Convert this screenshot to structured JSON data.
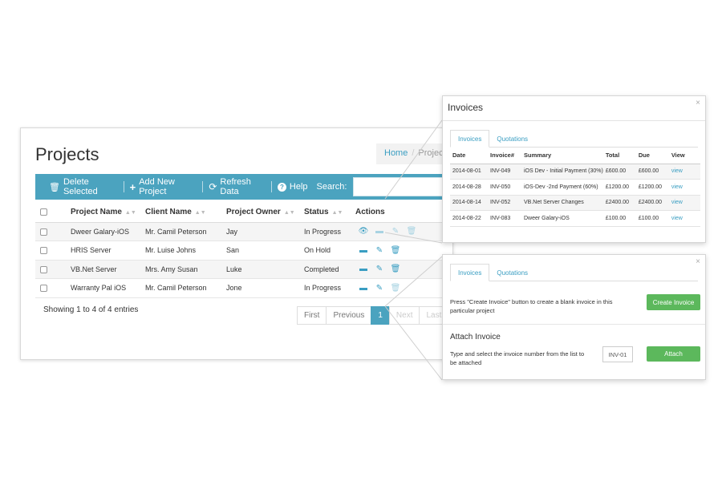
{
  "projects_panel": {
    "title": "Projects",
    "breadcrumb": {
      "home": "Home",
      "separator": "/",
      "current": "Project"
    },
    "toolbar": {
      "delete_selected": "Delete Selected",
      "add_new_project": "Add New Project",
      "refresh_data": "Refresh Data",
      "help": "Help",
      "search_label": "Search:",
      "search_value": ""
    },
    "table": {
      "headers": [
        "Project Name",
        "Client Name",
        "Project Owner",
        "Status",
        "Actions"
      ],
      "rows": [
        {
          "project_name": "Dweer Galary-iOS",
          "client_name": "Mr. Camil Peterson",
          "project_owner": "Jay",
          "status": "In Progress"
        },
        {
          "project_name": "HRIS Server",
          "client_name": "Mr. Luise Johns",
          "project_owner": "San",
          "status": "On Hold"
        },
        {
          "project_name": "VB.Net Server",
          "client_name": "Mrs. Amy Susan",
          "project_owner": "Luke",
          "status": "Completed"
        },
        {
          "project_name": "Warranty Pal iOS",
          "client_name": "Mr. Camil Peterson",
          "project_owner": "Jone",
          "status": "In Progress"
        }
      ]
    },
    "showing_text": "Showing 1 to 4 of 4 entries",
    "pagination": {
      "first": "First",
      "previous": "Previous",
      "current_page": "1",
      "next": "Next",
      "last": "Last"
    }
  },
  "invoices_popup": {
    "title": "Invoices",
    "close": "×",
    "tabs": [
      "Invoices",
      "Quotations"
    ],
    "active_tab": "Invoices",
    "table": {
      "headers": [
        "Date",
        "Invoice#",
        "Summary",
        "Total",
        "Due",
        "View"
      ],
      "rows": [
        {
          "date": "2014-08-01",
          "invoice": "INV-049",
          "summary": "iOS Dev - Initial Payment (30%)",
          "total": "£600.00",
          "due": "£600.00",
          "view": "view"
        },
        {
          "date": "2014-08-28",
          "invoice": "INV-050",
          "summary": "iOS-Dev -2nd Payment (60%)",
          "total": "£1200.00",
          "due": "£1200.00",
          "view": "view"
        },
        {
          "date": "2014-08-14",
          "invoice": "INV-052",
          "summary": "VB.Net Server Changes",
          "total": "£2400.00",
          "due": "£2400.00",
          "view": "view"
        },
        {
          "date": "2014-08-22",
          "invoice": "INV-083",
          "summary": "Dweer Galary-iOS",
          "total": "£100.00",
          "due": "£100.00",
          "view": "view"
        }
      ]
    }
  },
  "create_popup": {
    "close": "×",
    "tabs": [
      "Invoices",
      "Quotations"
    ],
    "active_tab": "Invoices",
    "create_text": "Press \"Create Invoice\" button to create a blank invoice in this particular project",
    "create_button": "Create Invoice",
    "attach_title": "Attach Invoice",
    "attach_text": "Type and select the invoice number from the list to be attached",
    "invoice_input_value": "INV-01",
    "attach_button": "Attach"
  },
  "colors": {
    "toolbar_bg": "#4ba3bf",
    "link": "#3a9ec2",
    "green_button": "#5cb85c"
  }
}
